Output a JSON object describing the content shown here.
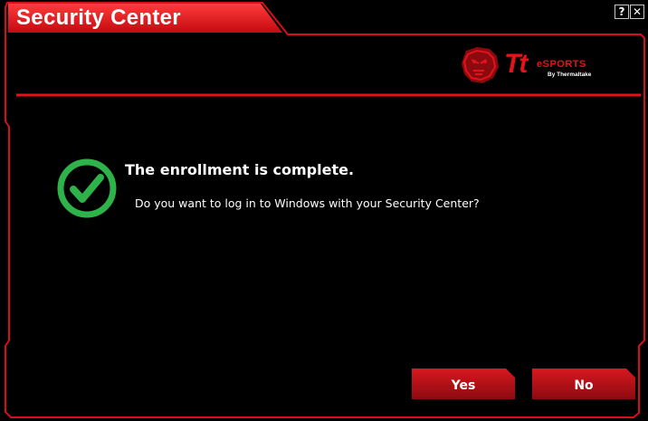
{
  "window": {
    "title": "Security Center",
    "controls": {
      "help_label": "?",
      "close_label": "✕"
    }
  },
  "brand": {
    "mark": "Tt",
    "name": "eSPORTS",
    "sub": "By Thermaltake",
    "accent_color": "#e3121b"
  },
  "message": {
    "heading": "The enrollment is complete.",
    "question": "Do you want to log in to Windows with your Security Center?",
    "icon": "check-circle-icon",
    "icon_color": "#2db34a"
  },
  "buttons": {
    "yes_label": "Yes",
    "no_label": "No"
  },
  "colors": {
    "background": "#000000",
    "frame": "#e3121b"
  }
}
